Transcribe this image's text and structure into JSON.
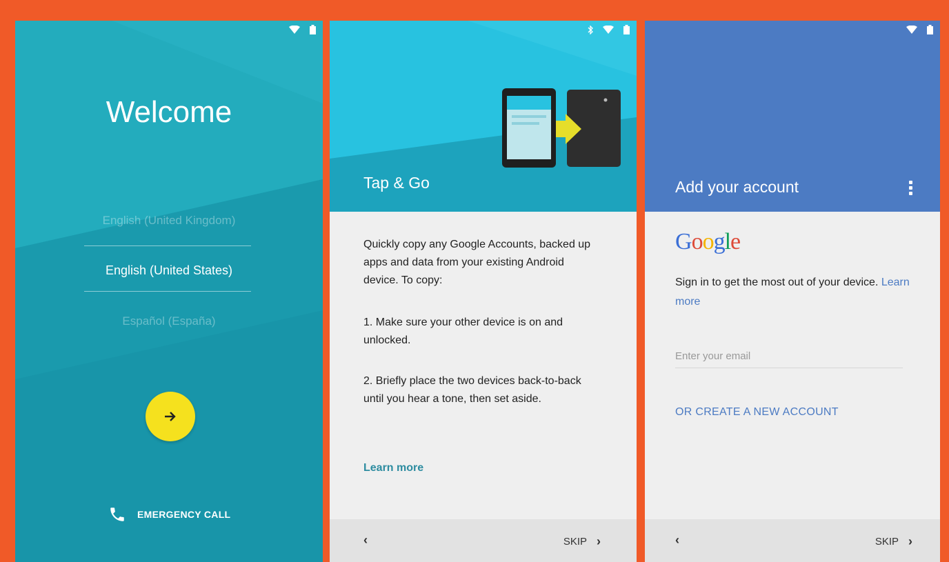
{
  "screen1": {
    "title": "Welcome",
    "languages": [
      "English (United Kingdom)",
      "English (United States)",
      "Español (España)"
    ],
    "selected_language": "English (United States)",
    "next_icon": "arrow-right-icon",
    "emergency_label": "EMERGENCY CALL",
    "colors": {
      "background": "#1ea3b5",
      "button": "#f5e11e"
    }
  },
  "screen2": {
    "title": "Tap & Go",
    "intro": "Quickly copy any Google Accounts, backed up apps and data from your existing Android device. To copy:",
    "step1": "1. Make sure your other device is on and unlocked.",
    "step2": "2. Briefly place the two devices back-to-back until you hear a tone, then set aside.",
    "learn_more": "Learn more",
    "nav": {
      "back": "‹",
      "skip": "SKIP",
      "skip_icon": "›"
    },
    "colors": {
      "header": "#28c2e0"
    }
  },
  "screen3": {
    "title": "Add your account",
    "logo": "Google",
    "description": "Sign in to get the most out of your device.",
    "learn_more": "Learn more",
    "email_placeholder": "Enter your email",
    "create_account": "OR CREATE A NEW ACCOUNT",
    "nav": {
      "back": "‹",
      "skip": "SKIP",
      "skip_icon": "›"
    },
    "colors": {
      "header": "#4c7bc3"
    }
  }
}
